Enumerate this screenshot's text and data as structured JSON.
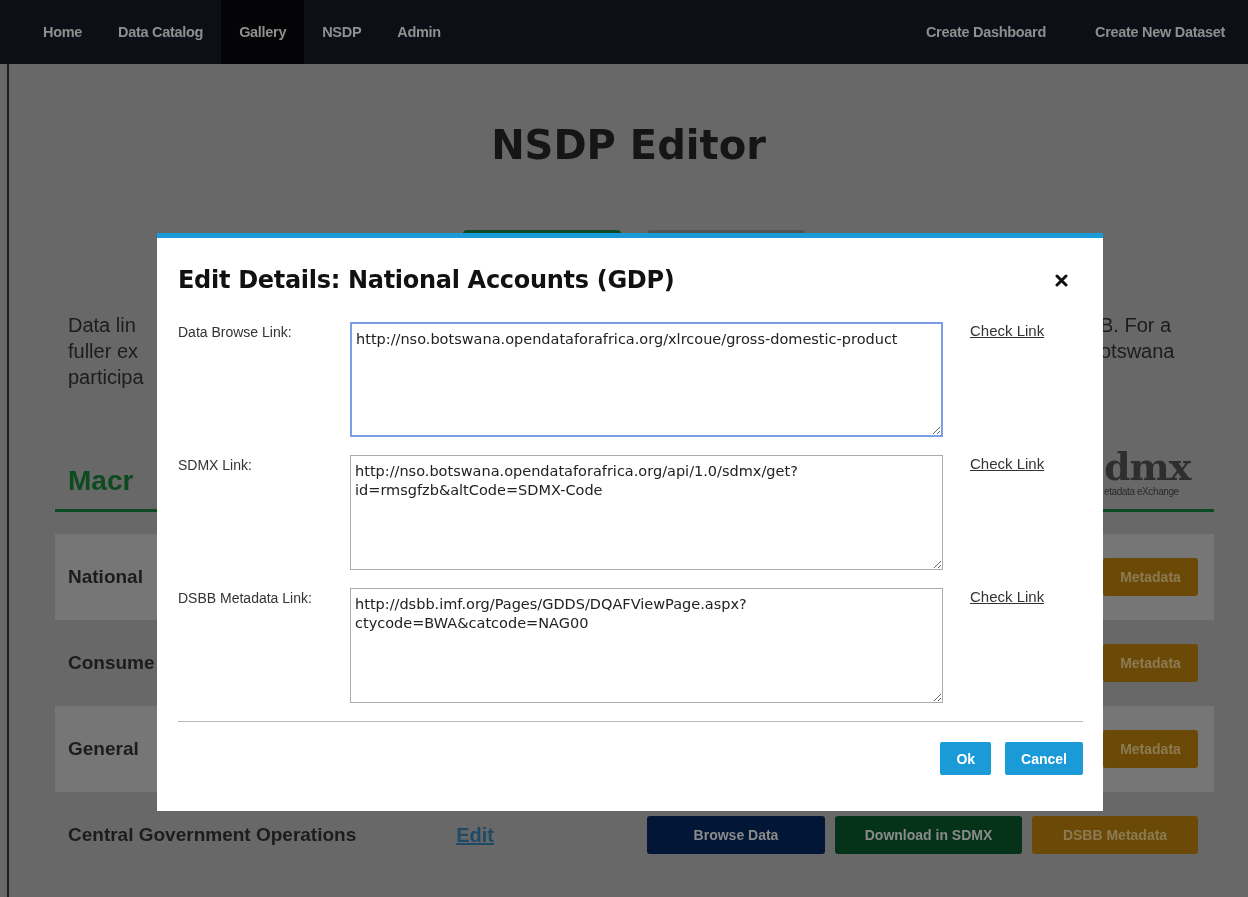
{
  "nav": {
    "items": [
      {
        "label": "Home",
        "selected": false
      },
      {
        "label": "Data Catalog",
        "selected": false
      },
      {
        "label": "Gallery",
        "selected": true
      },
      {
        "label": "NSDP",
        "selected": false
      },
      {
        "label": "Admin",
        "selected": false
      }
    ],
    "actions": [
      "Create Dashboard",
      "Create New Dataset"
    ]
  },
  "page": {
    "title": "NSDP Editor",
    "intro_left": [
      "Data lin",
      "fuller ex",
      "participa"
    ],
    "intro_right": [
      "B. For a",
      "otswana"
    ],
    "section_heading": "Macr",
    "logo": {
      "text": "dmx",
      "caption": "etadata eXchange"
    },
    "rows": [
      {
        "label": "National",
        "shaded": true,
        "buttons": [
          {
            "label": "Metadata",
            "kind": "metadata"
          }
        ]
      },
      {
        "label": "Consume",
        "shaded": false,
        "buttons": [
          {
            "label": "Metadata",
            "kind": "metadata"
          }
        ]
      },
      {
        "label": "General",
        "shaded": true,
        "buttons": [
          {
            "label": "Metadata",
            "kind": "metadata"
          }
        ]
      },
      {
        "label": "Central Government Operations",
        "shaded": false,
        "edit": "Edit",
        "buttons": [
          {
            "label": "Browse Data",
            "kind": "browse"
          },
          {
            "label": "Download in SDMX",
            "kind": "download"
          },
          {
            "label": "DSBB Metadata",
            "kind": "metadata"
          }
        ]
      }
    ]
  },
  "dialog": {
    "title": "Edit Details: National Accounts (GDP)",
    "fields": [
      {
        "label": "Data Browse Link:",
        "value": "http://nso.botswana.opendataforafrica.org/xlrcoue/gross-domestic-product",
        "focused": true,
        "check": "Check Link"
      },
      {
        "label": "SDMX Link:",
        "value": "http://nso.botswana.opendataforafrica.org/api/1.0/sdmx/get?id=rmsgfzb&altCode=SDMX-Code",
        "focused": false,
        "check": "Check Link"
      },
      {
        "label": "DSBB Metadata Link:",
        "value": "http://dsbb.imf.org/Pages/GDDS/DQAFViewPage.aspx?ctycode=BWA&catcode=NAG00",
        "focused": false,
        "check": "Check Link"
      }
    ],
    "buttons": [
      "Ok",
      "Cancel"
    ]
  }
}
